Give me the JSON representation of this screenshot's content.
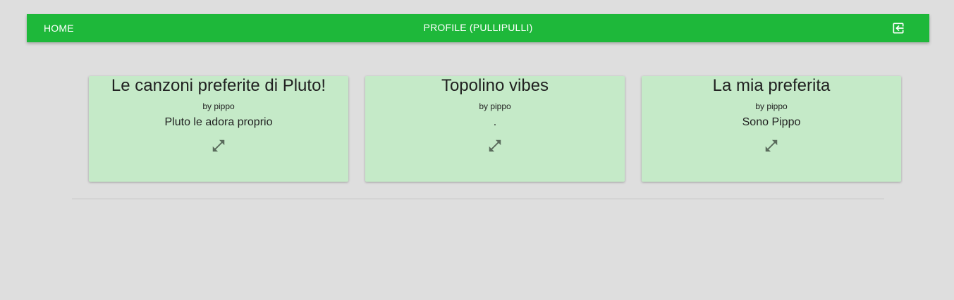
{
  "nav": {
    "home_label": "HOME",
    "profile_label": "PROFILE (PULLIPULLI)",
    "logout_icon": "logout-icon",
    "bar_color": "#1eb83a"
  },
  "playlists": [
    {
      "title": "Le canzoni preferite di Pluto!",
      "author": "by pippo",
      "description": "Pluto le adora proprio",
      "action_icon": "expand-icon"
    },
    {
      "title": "Topolino vibes",
      "author": "by pippo",
      "description": ".",
      "action_icon": "expand-icon"
    },
    {
      "title": "La mia preferita",
      "author": "by pippo",
      "description": "Sono Pippo",
      "action_icon": "expand-icon"
    }
  ],
  "colors": {
    "card_background": "#c5eac8",
    "page_background": "#dedede",
    "icon_color": "#5a6b5c"
  }
}
